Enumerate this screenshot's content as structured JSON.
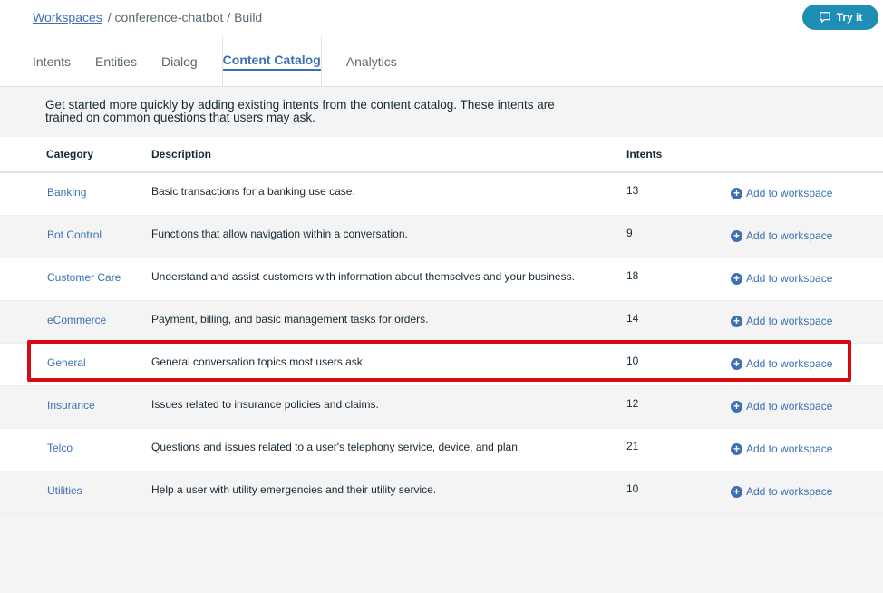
{
  "breadcrumb": {
    "root": "Workspaces",
    "rest": "/ conference-chatbot / Build"
  },
  "try_it": {
    "label": "Try it",
    "icon": "chat-icon"
  },
  "tabs": [
    {
      "label": "Intents",
      "active": false
    },
    {
      "label": "Entities",
      "active": false
    },
    {
      "label": "Dialog",
      "active": false
    },
    {
      "label": "Content Catalog",
      "active": true
    },
    {
      "label": "Analytics",
      "active": false
    }
  ],
  "intro": {
    "text": "Get started more quickly by adding existing intents from the content catalog. These intents are trained on common questions that users may ask."
  },
  "table": {
    "columns": [
      "Category",
      "Description",
      "Intents"
    ],
    "add_label": "Add to workspace",
    "rows": [
      {
        "category": "Banking",
        "description": "Basic transactions for a banking use case.",
        "intents": "13"
      },
      {
        "category": "Bot Control",
        "description": "Functions that allow navigation within a conversation.",
        "intents": "9"
      },
      {
        "category": "Customer Care",
        "description": "Understand and assist customers with information about themselves and your business.",
        "intents": "18"
      },
      {
        "category": "eCommerce",
        "description": "Payment, billing, and basic management tasks for orders.",
        "intents": "14"
      },
      {
        "category": "General",
        "description": "General conversation topics most users ask.",
        "intents": "10"
      },
      {
        "category": "Insurance",
        "description": "Issues related to insurance policies and claims.",
        "intents": "12"
      },
      {
        "category": "Telco",
        "description": "Questions and issues related to a user's telephony service, device, and plan.",
        "intents": "21"
      },
      {
        "category": "Utilities",
        "description": "Help a user with utility emergencies and their utility service.",
        "intents": "10"
      }
    ]
  },
  "highlight": {
    "row": "General",
    "color": "#d60a10"
  },
  "colors": {
    "accent": "#3d70b2",
    "try_it": "#1f8eb4"
  }
}
